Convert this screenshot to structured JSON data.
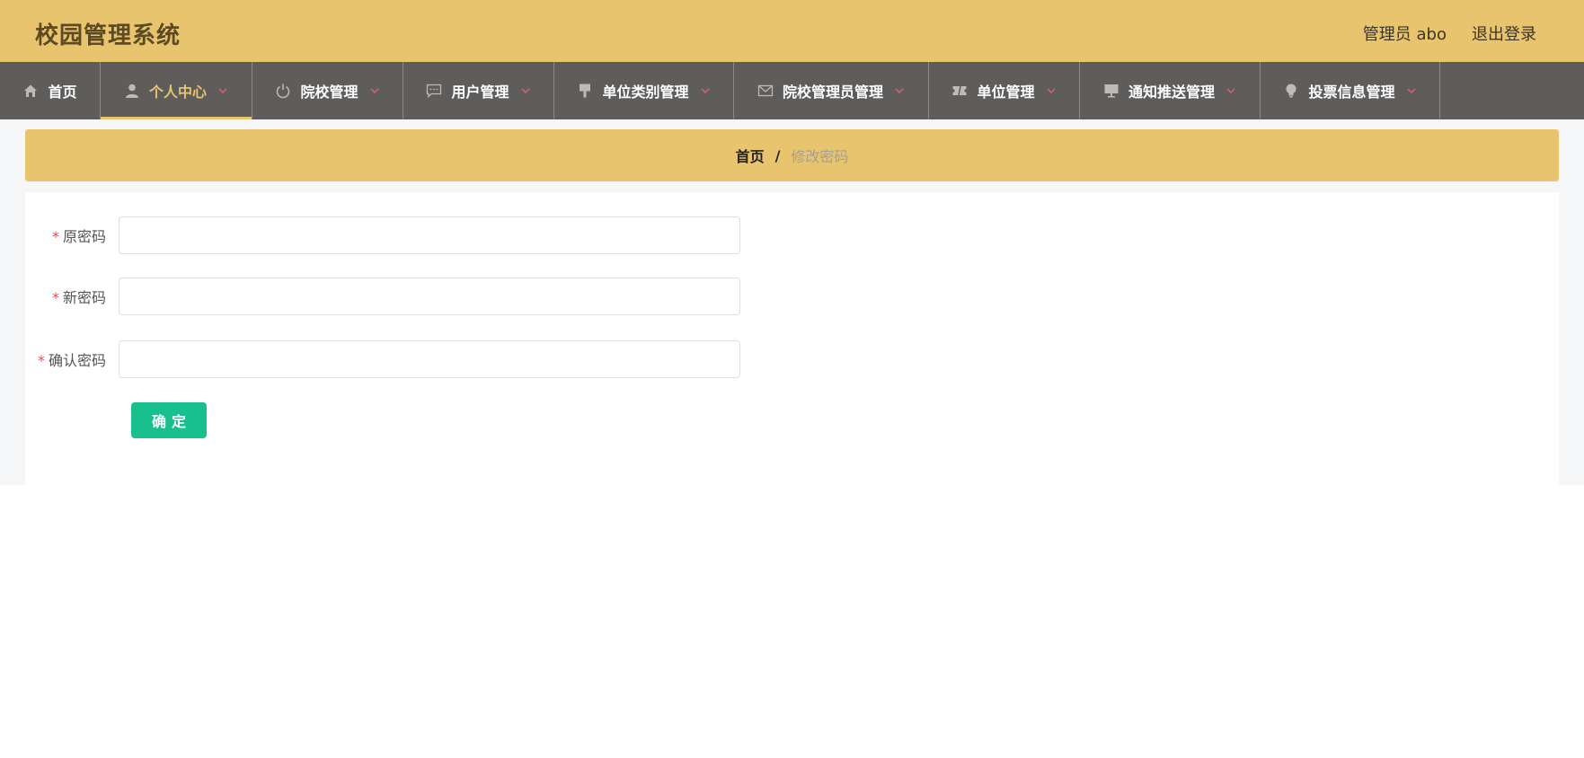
{
  "app": {
    "title": "校园管理系统"
  },
  "header": {
    "user_label": "管理员 abo",
    "logout_label": "退出登录"
  },
  "nav": {
    "items": [
      {
        "label": "首页",
        "icon": "home-icon",
        "dropdown": false,
        "active": false
      },
      {
        "label": "个人中心",
        "icon": "user-icon",
        "dropdown": true,
        "active": true
      },
      {
        "label": "院校管理",
        "icon": "power-icon",
        "dropdown": true,
        "active": false
      },
      {
        "label": "用户管理",
        "icon": "chat-icon",
        "dropdown": true,
        "active": false
      },
      {
        "label": "单位类别管理",
        "icon": "brush-icon",
        "dropdown": true,
        "active": false
      },
      {
        "label": "院校管理员管理",
        "icon": "mail-icon",
        "dropdown": true,
        "active": false
      },
      {
        "label": "单位管理",
        "icon": "ticket-icon",
        "dropdown": true,
        "active": false
      },
      {
        "label": "通知推送管理",
        "icon": "monitor-icon",
        "dropdown": true,
        "active": false
      },
      {
        "label": "投票信息管理",
        "icon": "bulb-icon",
        "dropdown": true,
        "active": false
      }
    ]
  },
  "breadcrumb": {
    "home": "首页",
    "separator": "/",
    "current": "修改密码"
  },
  "form": {
    "required_mark": "*",
    "fields": [
      {
        "label": "原密码",
        "value": "",
        "placeholder": ""
      },
      {
        "label": "新密码",
        "value": "",
        "placeholder": ""
      },
      {
        "label": "确认密码",
        "value": "",
        "placeholder": ""
      }
    ],
    "submit_label": "确定"
  },
  "colors": {
    "header_bg": "#e8c46e",
    "nav_bg": "#5f5d5b",
    "active_nav": "#e8c46e",
    "chevron": "#d9607a",
    "submit_bg": "#17c08d",
    "required": "#e05050"
  }
}
